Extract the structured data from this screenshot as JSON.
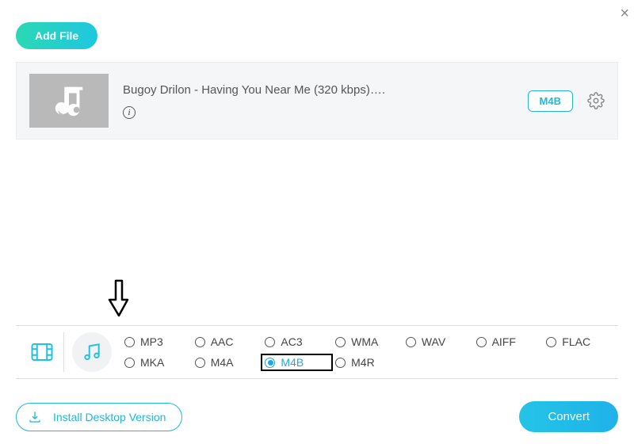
{
  "header": {
    "add_file_label": "Add File"
  },
  "file": {
    "title": "Bugoy Drilon - Having You Near Me (320 kbps)….",
    "format_badge": "M4B"
  },
  "formats": {
    "row1": [
      "MP3",
      "AAC",
      "AC3",
      "WMA",
      "WAV",
      "AIFF",
      "FLAC"
    ],
    "row2": [
      "MKA",
      "M4A",
      "M4B",
      "M4R"
    ],
    "selected": "M4B"
  },
  "footer": {
    "install_label": "Install Desktop Version",
    "convert_label": "Convert"
  }
}
